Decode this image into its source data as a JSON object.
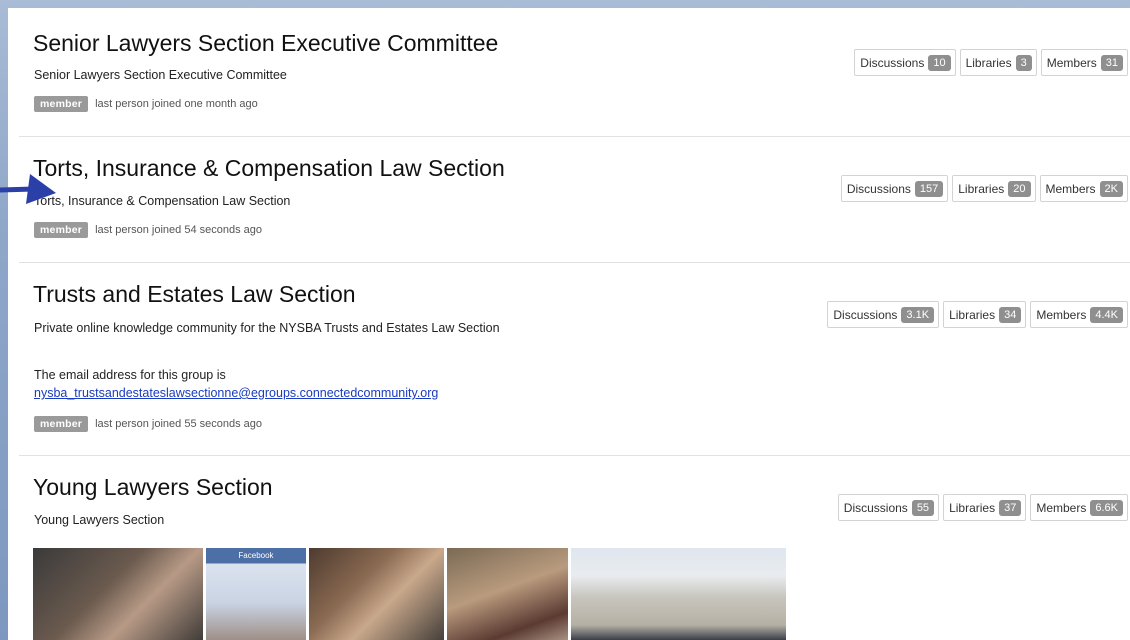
{
  "groups": [
    {
      "title": "Senior Lawyers Section Executive Committee",
      "description": "Senior Lawyers Section Executive Committee",
      "badge": "member",
      "joined": "last person joined one month ago",
      "stats": {
        "discussions_label": "Discussions",
        "discussions": "10",
        "libraries_label": "Libraries",
        "libraries": "3",
        "members_label": "Members",
        "members": "31"
      }
    },
    {
      "title": "Torts, Insurance & Compensation Law Section",
      "description": "Torts, Insurance & Compensation Law Section",
      "badge": "member",
      "joined": "last person joined 54 seconds ago",
      "stats": {
        "discussions_label": "Discussions",
        "discussions": "157",
        "libraries_label": "Libraries",
        "libraries": "20",
        "members_label": "Members",
        "members": "2K"
      }
    },
    {
      "title": "Trusts and Estates Law Section",
      "description": "Private online knowledge community for the NYSBA Trusts and Estates Law Section",
      "note": "The email address for this group is",
      "email": "nysba_trustsandestateslawsectionne@egroups.connectedcommunity.org",
      "badge": "member",
      "joined": "last person joined 55 seconds ago",
      "stats": {
        "discussions_label": "Discussions",
        "discussions": "3.1K",
        "libraries_label": "Libraries",
        "libraries": "34",
        "members_label": "Members",
        "members": "4.4K"
      }
    },
    {
      "title": "Young Lawyers Section",
      "description": "Young Lawyers Section",
      "photo_caption": "Facebook",
      "stats": {
        "discussions_label": "Discussions",
        "discussions": "55",
        "libraries_label": "Libraries",
        "libraries": "37",
        "members_label": "Members",
        "members": "6.6K"
      }
    }
  ],
  "annotation": {
    "arrow_color": "#2b3fa8"
  }
}
